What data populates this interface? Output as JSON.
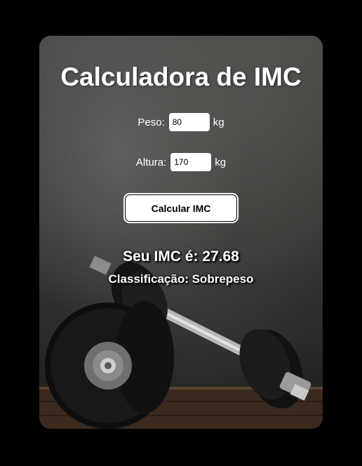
{
  "app": {
    "title": "Calculadora de IMC"
  },
  "form": {
    "peso_label": "Peso:",
    "peso_value": "80",
    "peso_unit": "kg",
    "altura_label": "Altura:",
    "altura_value": "170",
    "altura_unit": "kg",
    "button_label": "Calcular IMC"
  },
  "result": {
    "imc_text": "Seu IMC é: 27.68",
    "classification_text": "Classificação: Sobrepeso"
  },
  "background": {
    "image": "dumbbells-photo"
  }
}
